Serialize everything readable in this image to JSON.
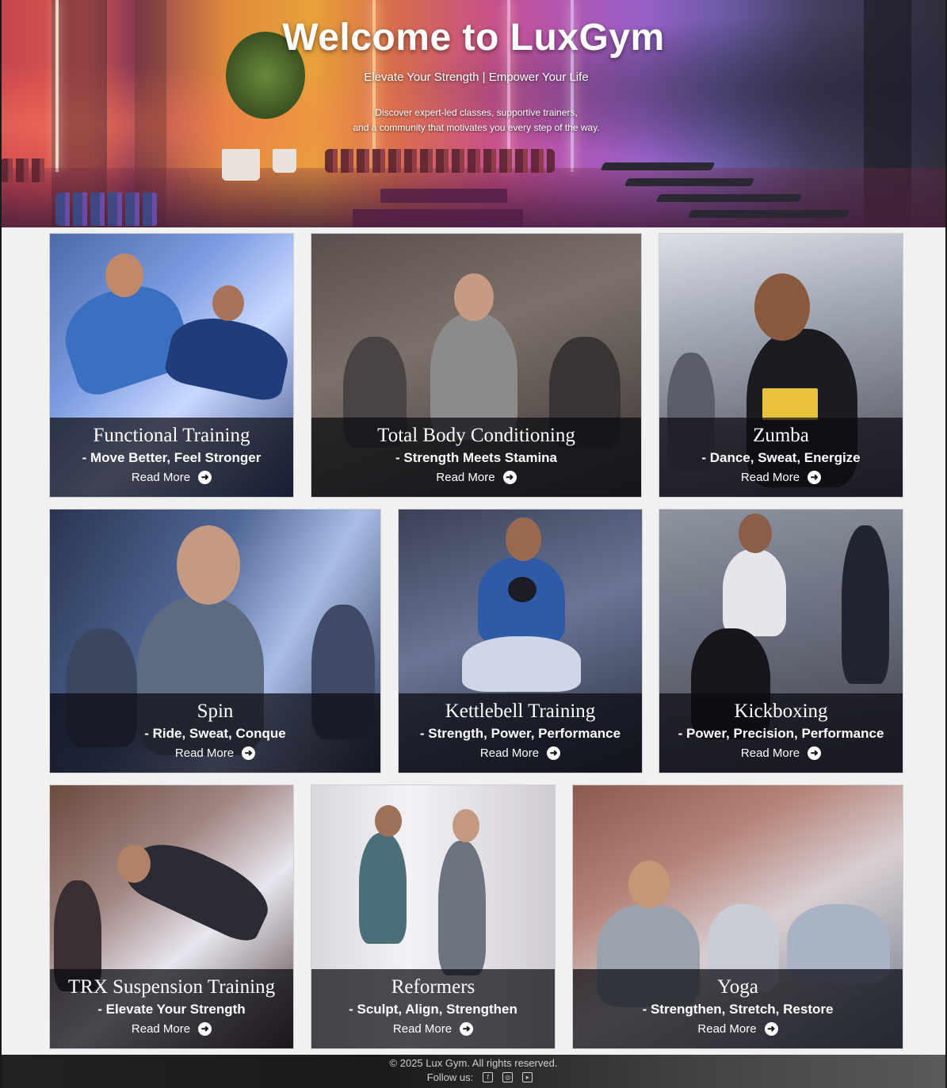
{
  "hero": {
    "title": "Welcome to LuxGym",
    "subtitle": "Elevate Your Strength | Empower Your Life",
    "description_line1": "Discover expert-led classes, supportive trainers,",
    "description_line2": "and a community that motivates you every step of the way."
  },
  "classes": [
    {
      "title": "Functional Training",
      "tagline": "- Move Better, Feel Stronger",
      "link": "Read More"
    },
    {
      "title": "Total Body Conditioning",
      "tagline": "- Strength Meets Stamina",
      "link": "Read More"
    },
    {
      "title": "Zumba",
      "tagline": "- Dance, Sweat, Energize",
      "link": "Read More"
    },
    {
      "title": "Spin",
      "tagline": "- Ride, Sweat, Conque",
      "link": "Read More"
    },
    {
      "title": "Kettlebell Training",
      "tagline": "- Strength, Power, Performance",
      "link": "Read More"
    },
    {
      "title": "Kickboxing",
      "tagline": "- Power, Precision, Performance",
      "link": "Read More"
    },
    {
      "title": "TRX Suspension Training",
      "tagline": "- Elevate Your Strength",
      "link": "Read More"
    },
    {
      "title": "Reformers",
      "tagline": "- Sculpt, Align, Strengthen",
      "link": "Read More"
    },
    {
      "title": "Yoga",
      "tagline": "- Strengthen, Stretch, Restore",
      "link": "Read More"
    }
  ],
  "icons": {
    "read_more": "arrow-right-circle-icon",
    "social": [
      "facebook-icon",
      "instagram-icon",
      "youtube-icon"
    ]
  },
  "footer": {
    "copyright": "© 2025 Lux Gym. All rights reserved.",
    "follow_label": "Follow us:"
  }
}
